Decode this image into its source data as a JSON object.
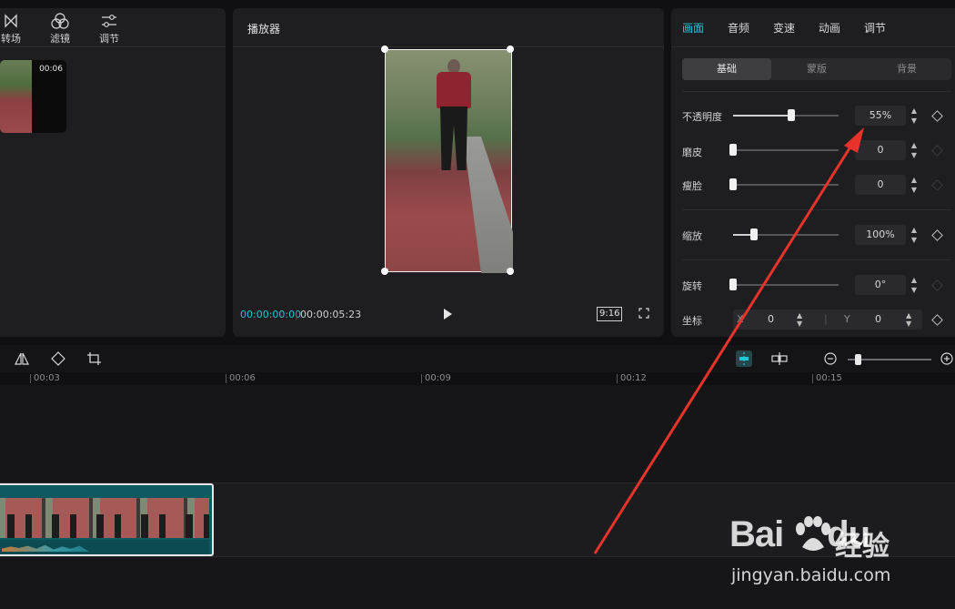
{
  "media": {
    "tabs": [
      {
        "label": "转场",
        "icon": "transition-icon"
      },
      {
        "label": "滤镜",
        "icon": "filter-icon"
      },
      {
        "label": "调节",
        "icon": "adjust-icon"
      }
    ],
    "clip_duration": "00:06"
  },
  "player": {
    "title": "播放器",
    "current_time": "00:00:00:00",
    "total_time": "00:00:05:23",
    "ratio": "9:16"
  },
  "props": {
    "tabs": [
      "画面",
      "音频",
      "变速",
      "动画",
      "调节"
    ],
    "active_tab": "画面",
    "segments": [
      "基础",
      "蒙版",
      "背景"
    ],
    "active_segment": "基础",
    "rows": {
      "opacity": {
        "label": "不透明度",
        "value": "55%",
        "level": 0.55
      },
      "smooth": {
        "label": "磨皮",
        "value": "0",
        "level": 0
      },
      "slim": {
        "label": "瘦脸",
        "value": "0",
        "level": 0
      },
      "scale": {
        "label": "缩放",
        "value": "100%",
        "level": 0.2
      },
      "rotate": {
        "label": "旋转",
        "value": "0°",
        "level": 0
      }
    },
    "position": {
      "label": "坐标",
      "x_label": "X",
      "x_value": "0",
      "y_label": "Y",
      "y_value": "0"
    }
  },
  "timeline": {
    "ticks": [
      "00:03",
      "00:06",
      "00:09",
      "00:12",
      "00:15"
    ]
  },
  "watermark": {
    "brand": "Bai",
    "brand_tail": "du",
    "suffix": "经验",
    "url": "jingyan.baidu.com"
  },
  "colors": {
    "accent": "#22c7d4",
    "annotation_arrow": "#e8332b",
    "clip": "#0f5a60"
  }
}
